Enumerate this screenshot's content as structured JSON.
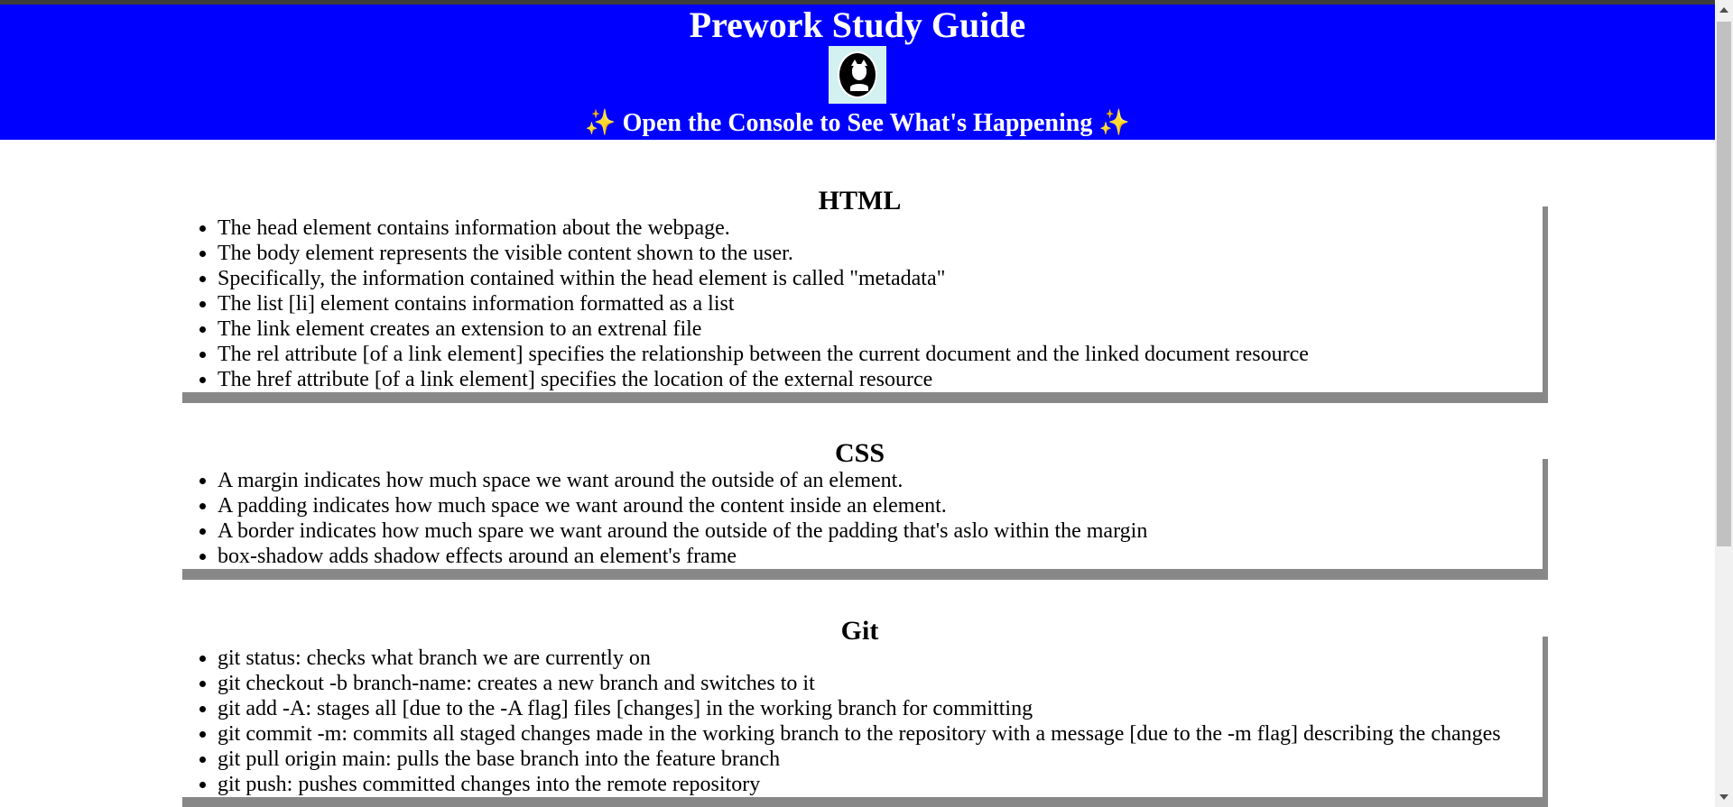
{
  "header": {
    "title": "Prework Study Guide",
    "logo_icon": "skeleton-cat-avatar",
    "subtitle_prefix": "✨",
    "subtitle": "Open the Console to See What's Happening",
    "subtitle_suffix": "✨",
    "background": "#0000ff"
  },
  "sections": [
    {
      "title": "HTML",
      "items": [
        "The head element contains information about the webpage.",
        "The body element represents the visible content shown to the user.",
        "Specifically, the information contained within the head element is called \"metadata\"",
        "The list [li] element contains information formatted as a list",
        "The link element creates an extension to an extrenal file",
        "The rel attribute [of a link element] specifies the relationship between the current document and the linked document resource",
        "The href attribute [of a link element] specifies the location of the external resource"
      ]
    },
    {
      "title": "CSS",
      "items": [
        "A margin indicates how much space we want around the outside of an element.",
        "A padding indicates how much space we want around the content inside an element.",
        "A border indicates how much spare we want around the outside of the padding that's aslo within the margin",
        "box-shadow adds shadow effects around an element's frame"
      ]
    },
    {
      "title": "Git",
      "items": [
        "git status: checks what branch we are currently on",
        "git checkout -b branch-name: creates a new branch and switches to it",
        "git add -A: stages all [due to the -A flag] files [changes] in the working branch for committing",
        "git commit -m: commits all staged changes made in the working branch to the repository with a message [due to the -m flag] describing the changes",
        "git pull origin main: pulls the base branch into the feature branch",
        "git push: pushes committed changes into the remote repository"
      ]
    }
  ]
}
